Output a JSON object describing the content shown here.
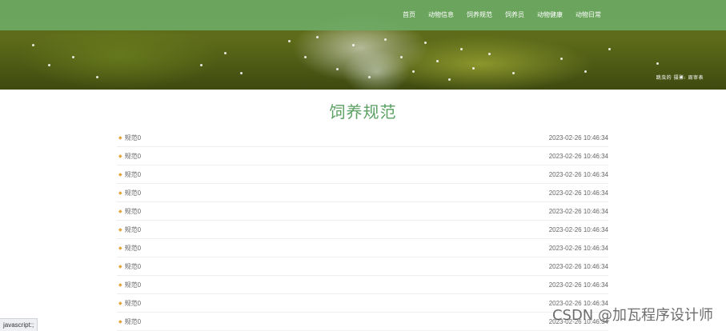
{
  "nav": {
    "items": [
      "首页",
      "动物信息",
      "饲养规范",
      "饲养员",
      "动物健康",
      "动物日常"
    ]
  },
  "banner": {
    "credit": "跳虫的 摄影: 周审表"
  },
  "main": {
    "title": "饲养规范",
    "rows": [
      {
        "title": "规范0",
        "date": "2023-02-26 10:46:34"
      },
      {
        "title": "规范0",
        "date": "2023-02-26 10:46:34"
      },
      {
        "title": "规范0",
        "date": "2023-02-26 10:46:34"
      },
      {
        "title": "规范0",
        "date": "2023-02-26 10:46:34"
      },
      {
        "title": "规范0",
        "date": "2023-02-26 10:46:34"
      },
      {
        "title": "规范0",
        "date": "2023-02-26 10:46:34"
      },
      {
        "title": "规范0",
        "date": "2023-02-26 10:46:34"
      },
      {
        "title": "规范0",
        "date": "2023-02-26 10:46:34"
      },
      {
        "title": "规范0",
        "date": "2023-02-26 10:46:34"
      },
      {
        "title": "规范0",
        "date": "2023-02-26 10:46:34"
      },
      {
        "title": "规范0",
        "date": "2023-02-26 10:46:34"
      }
    ]
  },
  "status": {
    "url": "javascript:;"
  },
  "watermark": "CSDN @加瓦程序设计师",
  "colors": {
    "nav_bg": "#6eaa64",
    "title": "#5aa062",
    "bullet": "#e3a53a",
    "text": "#666666"
  }
}
